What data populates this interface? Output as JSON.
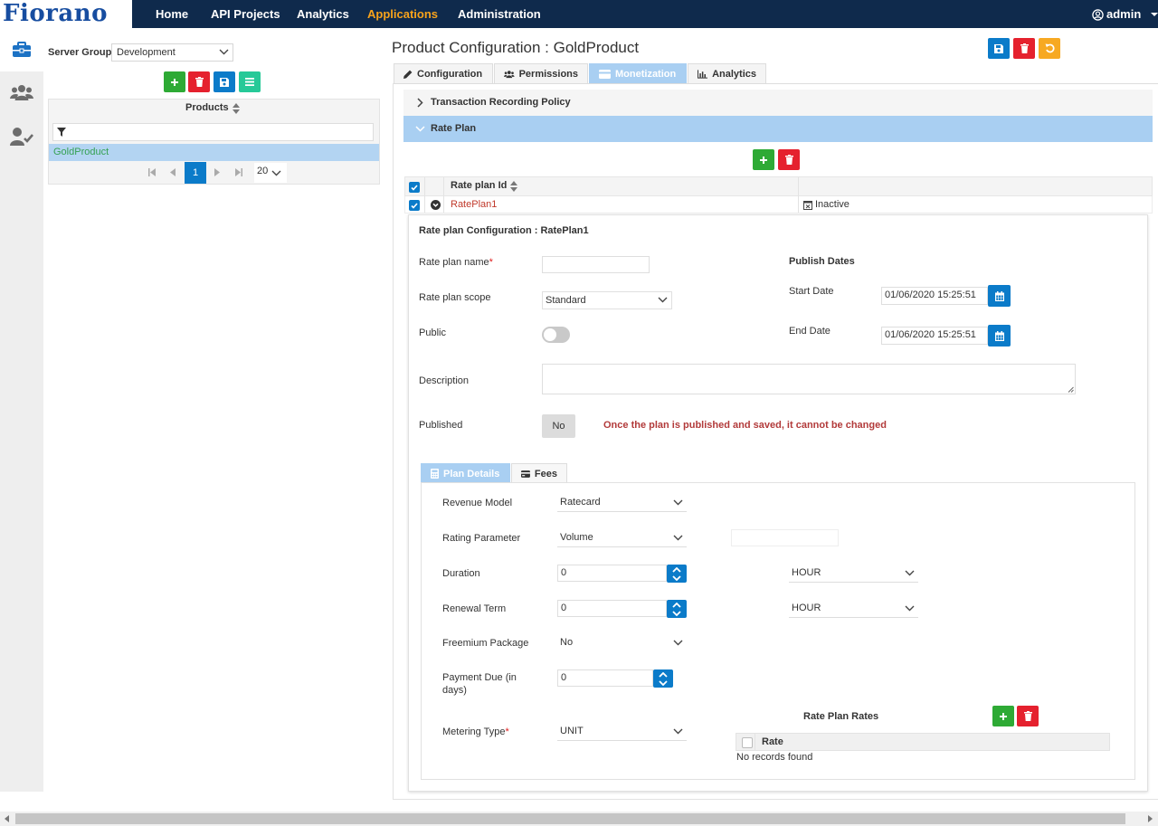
{
  "app": {
    "logo": "Fiorano"
  },
  "nav": {
    "items": [
      "Home",
      "API Projects",
      "Analytics",
      "Applications",
      "Administration"
    ],
    "active": "Applications",
    "user": "admin"
  },
  "left": {
    "server_group_label": "Server Group",
    "server_group_value": "Development",
    "products_header": "Products",
    "products": [
      "GoldProduct"
    ],
    "pager": {
      "current_page": "1",
      "page_size": "20"
    }
  },
  "main": {
    "title": "Product Configuration : GoldProduct",
    "tabs": [
      "Configuration",
      "Permissions",
      "Monetization",
      "Analytics"
    ],
    "active_tab": "Monetization",
    "sections": {
      "transaction": "Transaction Recording Policy",
      "rate_plan": "Rate Plan"
    },
    "rate_table": {
      "column": "Rate plan Id",
      "rows": [
        {
          "id": "RatePlan1",
          "status": "Inactive"
        }
      ]
    },
    "config": {
      "title": "Rate plan Configuration : RatePlan1",
      "name_label": "Rate plan name",
      "required_mark": "*",
      "name_value": "",
      "scope_label": "Rate plan scope",
      "scope_value": "Standard",
      "public_label": "Public",
      "public_on": false,
      "description_label": "Description",
      "published_label": "Published",
      "published_value": "No",
      "published_warning": "Once the plan is published and saved, it cannot be changed",
      "publish_dates_label": "Publish Dates",
      "start_date_label": "Start Date",
      "start_date_value": "01/06/2020 15:25:51",
      "end_date_label": "End Date",
      "end_date_value": "01/06/2020 15:25:51"
    },
    "sub_tabs": [
      "Plan Details",
      "Fees"
    ],
    "active_sub_tab": "Plan Details",
    "plan_details": {
      "revenue_model_label": "Revenue Model",
      "revenue_model_value": "Ratecard",
      "rating_parameter_label": "Rating Parameter",
      "rating_parameter_value": "Volume",
      "rating_parameter_extra": "",
      "duration_label": "Duration",
      "duration_value": "0",
      "duration_unit": "HOUR",
      "renewal_label": "Renewal Term",
      "renewal_value": "0",
      "renewal_unit": "HOUR",
      "freemium_label": "Freemium Package",
      "freemium_value": "No",
      "payment_due_label": "Payment Due (in days)",
      "payment_due_value": "0",
      "metering_label": "Metering Type",
      "metering_value": "UNIT",
      "rates_title": "Rate Plan Rates",
      "rates_column": "Rate",
      "rates_empty": "No records found"
    }
  },
  "colors": {
    "topbar": "#0f2a4c",
    "active_nav": "#f8a31b",
    "primary": "#0b7bc9",
    "add": "#2eaa35",
    "delete": "#e5212e",
    "reset": "#f7a922",
    "selected_row": "#b3d4f2"
  }
}
